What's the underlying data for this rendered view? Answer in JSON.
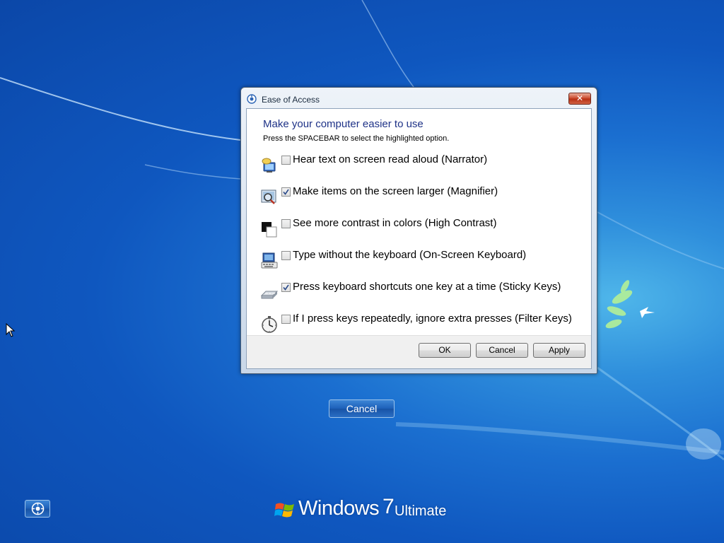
{
  "dialog": {
    "title": "Ease of Access",
    "close_glyph": "✕",
    "heading": "Make your computer easier to use",
    "instruction": "Press the SPACEBAR to select the highlighted option.",
    "options": [
      {
        "label": "Hear text on screen read aloud (Narrator)",
        "checked": false,
        "icon": "narrator-icon"
      },
      {
        "label": "Make items on the screen larger (Magnifier)",
        "checked": true,
        "icon": "magnifier-icon"
      },
      {
        "label": "See more contrast in colors (High Contrast)",
        "checked": false,
        "icon": "high-contrast-icon"
      },
      {
        "label": "Type without the keyboard (On-Screen Keyboard)",
        "checked": false,
        "icon": "on-screen-keyboard-icon"
      },
      {
        "label": "Press keyboard shortcuts one key at a time (Sticky Keys)",
        "checked": true,
        "icon": "sticky-keys-icon"
      },
      {
        "label": "If I press keys repeatedly, ignore extra presses (Filter Keys)",
        "checked": false,
        "icon": "filter-keys-icon"
      }
    ],
    "buttons": {
      "ok": "OK",
      "cancel": "Cancel",
      "apply": "Apply"
    }
  },
  "logon": {
    "cancel_label": "Cancel",
    "ease_of_access_icon": "ease-of-access-icon"
  },
  "branding": {
    "product": "Windows",
    "version": "7",
    "edition": "Ultimate"
  },
  "colors": {
    "accent": "#1e3287",
    "desktop_blue": "#1b6fd0",
    "close_red": "#c9462a"
  }
}
